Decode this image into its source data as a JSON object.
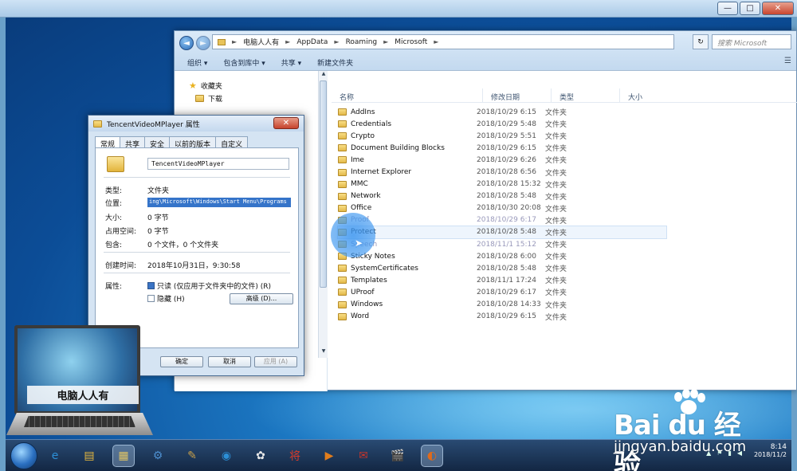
{
  "window_controls": {
    "minimize": "—",
    "maximize": "□",
    "close": "✕"
  },
  "explorer": {
    "back": "◄",
    "forward": "►",
    "breadcrumb": [
      "电脑人人有",
      "AppData",
      "Roaming",
      "Microsoft"
    ],
    "refresh": "↻",
    "search_placeholder": "搜索 Microsoft",
    "toolbar": [
      "组织 ▾",
      "包含到库中 ▾",
      "共享 ▾",
      "新建文件夹"
    ],
    "view_icon": "☰",
    "nav": [
      {
        "label": "收藏夹"
      },
      {
        "label": "下载"
      }
    ],
    "columns": [
      "名称",
      "修改日期",
      "类型",
      "大小"
    ],
    "rows": [
      {
        "name": "AddIns",
        "date": "2018/10/29 6:15",
        "type": "文件夹"
      },
      {
        "name": "Credentials",
        "date": "2018/10/29 5:48",
        "type": "文件夹"
      },
      {
        "name": "Crypto",
        "date": "2018/10/29 5:51",
        "type": "文件夹"
      },
      {
        "name": "Document Building Blocks",
        "date": "2018/10/29 6:15",
        "type": "文件夹"
      },
      {
        "name": "Ime",
        "date": "2018/10/29 6:26",
        "type": "文件夹"
      },
      {
        "name": "Internet Explorer",
        "date": "2018/10/28 6:56",
        "type": "文件夹"
      },
      {
        "name": "MMC",
        "date": "2018/10/28 15:32",
        "type": "文件夹"
      },
      {
        "name": "Network",
        "date": "2018/10/28 5:48",
        "type": "文件夹"
      },
      {
        "name": "Office",
        "date": "2018/10/30 20:08",
        "type": "文件夹"
      },
      {
        "name": "Proof",
        "date": "2018/10/29 6:17",
        "type": "文件夹"
      },
      {
        "name": "Protect",
        "date": "2018/10/28 5:48",
        "type": "文件夹"
      },
      {
        "name": "Speech",
        "date": "2018/11/1 15:12",
        "type": "文件夹"
      },
      {
        "name": "Sticky Notes",
        "date": "2018/10/28 6:00",
        "type": "文件夹"
      },
      {
        "name": "SystemCertificates",
        "date": "2018/10/28 5:48",
        "type": "文件夹"
      },
      {
        "name": "Templates",
        "date": "2018/11/1 17:24",
        "type": "文件夹"
      },
      {
        "name": "UProof",
        "date": "2018/10/29 6:17",
        "type": "文件夹"
      },
      {
        "name": "Windows",
        "date": "2018/10/28 14:33",
        "type": "文件夹"
      },
      {
        "name": "Word",
        "date": "2018/10/29 6:15",
        "type": "文件夹"
      }
    ]
  },
  "properties": {
    "title": "TencentVideoMPlayer 属性",
    "close": "✕",
    "tabs": [
      "常规",
      "共享",
      "安全",
      "以前的版本",
      "自定义"
    ],
    "name_value": "TencentVideoMPlayer",
    "fields": [
      {
        "label": "类型:",
        "value": "文件夹"
      },
      {
        "label": "位置:",
        "value": "ing\\Microsoft\\Windows\\Start Menu\\Programs"
      },
      {
        "label": "大小:",
        "value": "0 字节"
      },
      {
        "label": "占用空间:",
        "value": "0 字节"
      },
      {
        "label": "包含:",
        "value": "0 个文件，0 个文件夹"
      },
      {
        "label": "创建时间:",
        "value": "2018年10月31日，9:30:58"
      },
      {
        "label": "属性:",
        "value": ""
      }
    ],
    "readonly_label": "只读 (仅应用于文件夹中的文件) (R)",
    "hidden_label": "隐藏 (H)",
    "advanced_label": "高级 (D)...",
    "ok": "确定",
    "cancel": "取消",
    "apply": "应用 (A)"
  },
  "logo_text": "电脑人人有",
  "taskbar": {
    "icons": [
      "e",
      "▤",
      "▦",
      "⚙",
      "✎",
      "◉",
      "✿",
      "将",
      "▶",
      "✉",
      "🎬",
      "◐"
    ],
    "tray_icons": [
      "▲",
      "⚑",
      "▮",
      "◀"
    ],
    "time": "8:14",
    "date": "2018/11/2"
  },
  "watermark": {
    "logo": "Bai du 经验",
    "url": "jingyan.baidu.com"
  }
}
